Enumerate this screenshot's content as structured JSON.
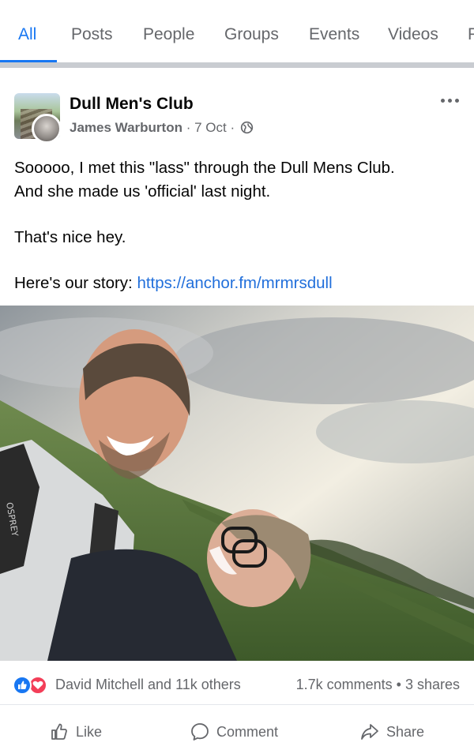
{
  "tabs": [
    {
      "label": "All",
      "active": true
    },
    {
      "label": "Posts"
    },
    {
      "label": "People"
    },
    {
      "label": "Groups"
    },
    {
      "label": "Events"
    },
    {
      "label": "Videos"
    },
    {
      "label": "P"
    }
  ],
  "post": {
    "group_name": "Dull Men's Club",
    "author": "James Warburton",
    "separator": "·",
    "date": "7 Oct",
    "privacy_icon": "globe-icon",
    "paragraphs": [
      {
        "line1": "Sooooo, I met this \"lass\" through the Dull Mens Club.",
        "line2": "And she made us 'official' last night."
      },
      {
        "line1": "That's nice hey."
      }
    ],
    "story_prefix": "Here's our story: ",
    "story_link": "https://anchor.fm/mrmrsdull",
    "photo": {
      "alt_desc": "photo",
      "backpack_text": "OSPREY"
    }
  },
  "reactions": {
    "icons": [
      "like-icon",
      "love-icon"
    ],
    "names": "David Mitchell and 11k others",
    "comments": "1.7k comments",
    "dot": "•",
    "shares": "3 shares"
  },
  "actions": {
    "like": "Like",
    "comment": "Comment",
    "share": "Share"
  },
  "colors": {
    "accent": "#1877f2",
    "link": "#216fdb",
    "secondary_text": "#65676b",
    "love": "#f33e58"
  }
}
